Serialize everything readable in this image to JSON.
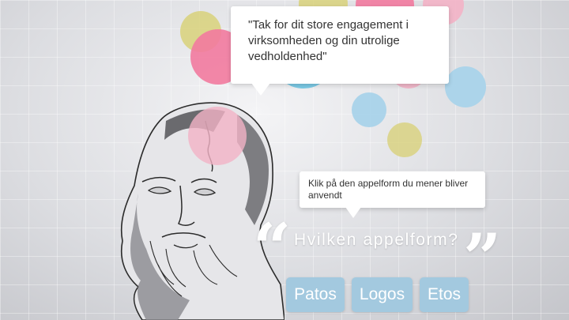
{
  "quote": {
    "text": "\"Tak for dit store engagement i virksomheden og din utrolige vedholdenhed\""
  },
  "instruction": {
    "text": "Klik på den appelform du mener bliver anvendt"
  },
  "question": {
    "text": "Hvilken appelform?",
    "open_quote": "“",
    "close_quote": "”"
  },
  "answers": [
    {
      "label": "Patos"
    },
    {
      "label": "Logos"
    },
    {
      "label": "Etos"
    }
  ],
  "colors": {
    "button": "#a3c9df",
    "bubble_pink": "#f27a9e",
    "bubble_blue": "#6fc7e6",
    "bubble_yellow": "#d8d17a",
    "bubble_light_blue": "#a9d3ea",
    "bubble_light_pink": "#f3b3c6"
  },
  "icons": {
    "bust": "aristotle-bust-illustration"
  }
}
